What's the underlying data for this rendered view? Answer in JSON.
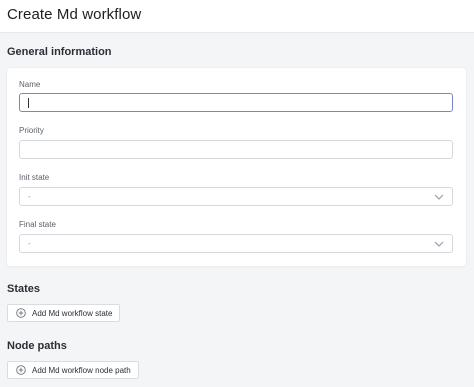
{
  "header": {
    "title": "Create Md workflow"
  },
  "general": {
    "title": "General information",
    "fields": {
      "name": {
        "label": "Name",
        "value": ""
      },
      "priority": {
        "label": "Priority",
        "value": ""
      },
      "init_state": {
        "label": "Init state",
        "value": "-"
      },
      "final_state": {
        "label": "Final state",
        "value": "-"
      }
    }
  },
  "states": {
    "title": "States",
    "add_label": "Add Md workflow state"
  },
  "node_paths": {
    "title": "Node paths",
    "add_label": "Add Md workflow node path"
  },
  "icons": {
    "add": "plus-circle-icon",
    "dropdown": "chevron-down-icon"
  },
  "colors": {
    "focus_border": "#7b86c9",
    "background": "#f4f5f7"
  }
}
